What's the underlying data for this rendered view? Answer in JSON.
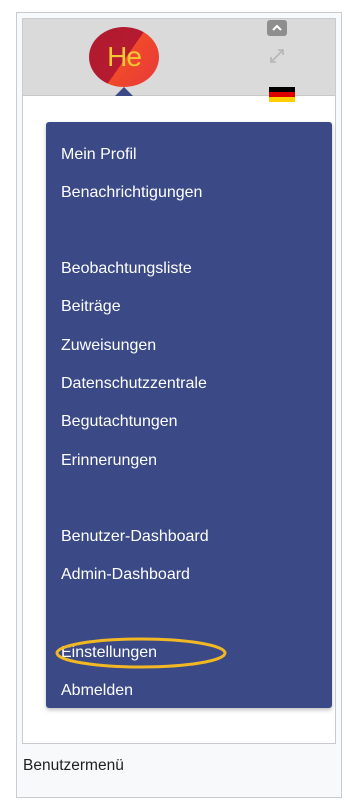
{
  "avatar": {
    "initials": "He"
  },
  "menu": {
    "items": [
      {
        "label": "Mein Profil"
      },
      {
        "label": "Benachrichtigungen"
      },
      {
        "label": "Beobachtungsliste"
      },
      {
        "label": "Beiträge"
      },
      {
        "label": "Zuweisungen"
      },
      {
        "label": "Datenschutzzentrale"
      },
      {
        "label": "Begutachtungen"
      },
      {
        "label": "Erinnerungen"
      },
      {
        "label": "Benutzer-Dashboard"
      },
      {
        "label": "Admin-Dashboard"
      },
      {
        "label": "Einstellungen",
        "highlighted": true
      },
      {
        "label": "Abmelden"
      }
    ]
  },
  "caption": "Benutzermenü",
  "colors": {
    "menu_background": "#3b4a86",
    "highlight": "#f2b824",
    "avatar_text": "#f6c733"
  },
  "icons": {
    "collapse": "chevron-up-icon",
    "expand": "expand-arrows-icon",
    "language": "german-flag-icon"
  }
}
